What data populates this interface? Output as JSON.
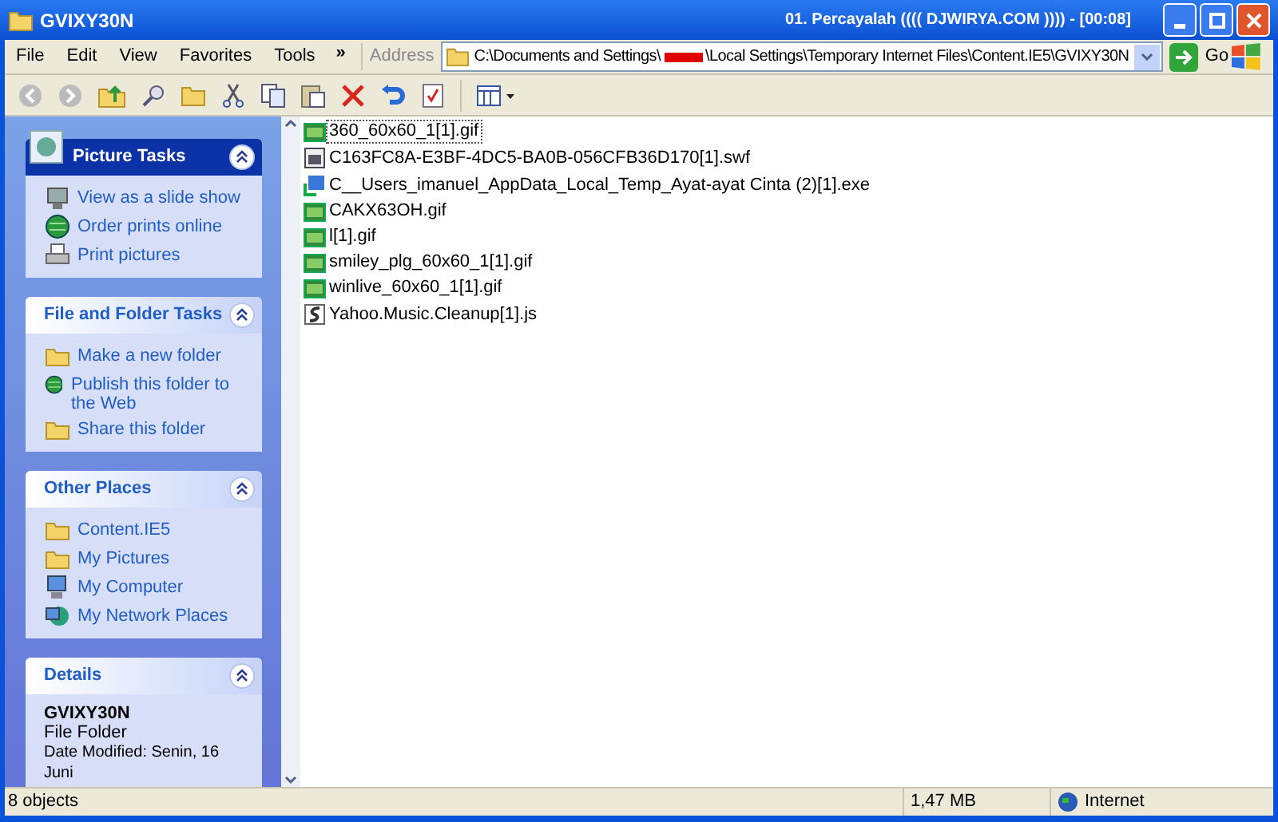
{
  "window": {
    "title": "GVIXY30N",
    "now_playing": "01. Percayalah (((( DJWIRYA.COM )))) - [00:08]"
  },
  "menu": [
    "File",
    "Edit",
    "View",
    "Favorites",
    "Tools"
  ],
  "menu_overflow": "»",
  "address": {
    "label": "Address",
    "path_start": "C:\\Documents and Settings\\",
    "path_end": "\\Local Settings\\Temporary Internet Files\\Content.IE5\\GVIXY30N",
    "go": "Go"
  },
  "panels": [
    {
      "kind": "special",
      "title": "Picture Tasks",
      "items": [
        {
          "kind": "slideshow",
          "label": "View as a slide show"
        },
        {
          "kind": "globe",
          "label": "Order prints online"
        },
        {
          "kind": "printer",
          "label": "Print pictures"
        }
      ]
    },
    {
      "kind": "normal",
      "title": "File and Folder Tasks",
      "items": [
        {
          "kind": "folder",
          "label": "Make a new folder"
        },
        {
          "kind": "globe",
          "label": "Publish this folder to the Web"
        },
        {
          "kind": "folder",
          "label": "Share this folder"
        }
      ]
    },
    {
      "kind": "normal",
      "title": "Other Places",
      "items": [
        {
          "kind": "folder",
          "label": "Content.IE5"
        },
        {
          "kind": "folder",
          "label": "My Pictures"
        },
        {
          "kind": "computer",
          "label": "My Computer"
        },
        {
          "kind": "network",
          "label": "My Network Places"
        }
      ]
    },
    {
      "kind": "details",
      "title": "Details",
      "name": "GVIXY30N",
      "type": "File Folder",
      "modified": "Date Modified: Senin, 16 Juni"
    }
  ],
  "files": [
    {
      "kind": "gif",
      "name": "360_60x60_1[1].gif",
      "focused": true
    },
    {
      "kind": "swf",
      "name": "C163FC8A-E3BF-4DC5-BA0B-056CFB36D170[1].swf",
      "focused": false
    },
    {
      "kind": "exe",
      "name": "C__Users_imanuel_AppData_Local_Temp_Ayat-ayat Cinta (2)[1].exe",
      "focused": false
    },
    {
      "kind": "gif",
      "name": "CAKX63OH.gif",
      "focused": false
    },
    {
      "kind": "gif",
      "name": "l[1].gif",
      "focused": false
    },
    {
      "kind": "gif",
      "name": "smiley_plg_60x60_1[1].gif",
      "focused": false
    },
    {
      "kind": "gif",
      "name": "winlive_60x60_1[1].gif",
      "focused": false
    },
    {
      "kind": "js",
      "name": "Yahoo.Music.Cleanup[1].js",
      "focused": false
    }
  ],
  "status_bar": {
    "objects": "8 objects",
    "size": "1,47 MB",
    "zone": "Internet"
  }
}
